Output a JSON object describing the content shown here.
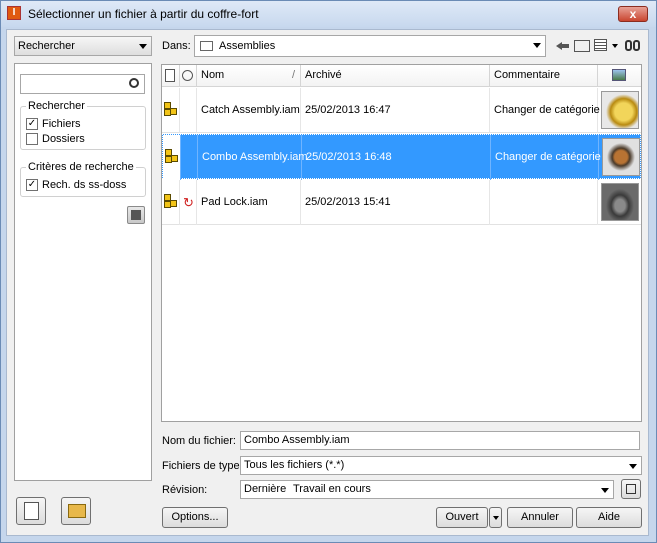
{
  "window": {
    "title": "Sélectionner un fichier à partir du coffre-fort",
    "close_label": "x",
    "app_icon": "I"
  },
  "left": {
    "mode_select": "Rechercher",
    "search_placeholder": "",
    "search_group_title": "Rechercher",
    "files_label": "Fichiers",
    "files_checked": true,
    "folders_label": "Dossiers",
    "folders_checked": false,
    "criteria_group_title": "Critères de recherche",
    "subfolders_label": "Rech. ds ss-doss",
    "subfolders_checked": true
  },
  "location": {
    "label": "Dans:",
    "folder": "Assemblies"
  },
  "grid": {
    "columns": {
      "name": "Nom",
      "archived": "Archivé",
      "comment": "Commentaire"
    },
    "rows": [
      {
        "name": "Catch Assembly.iam",
        "archived": "25/02/2013 16:47",
        "comment": "Changer de catégorie",
        "selected": false
      },
      {
        "name": "Combo Assembly.iam",
        "archived": "25/02/2013 16:48",
        "comment": "Changer de catégorie",
        "selected": true
      },
      {
        "name": "Pad Lock.iam",
        "archived": "25/02/2013 15:41",
        "comment": "",
        "selected": false
      }
    ]
  },
  "form": {
    "filename_label": "Nom du fichier:",
    "filename_value": "Combo Assembly.iam",
    "filetype_label": "Fichiers de type:",
    "filetype_value": "Tous les fichiers (*.*)",
    "revision_label": "Révision:",
    "revision_value": "Dernière",
    "revision_state": "Travail en cours"
  },
  "buttons": {
    "options": "Options...",
    "open": "Ouvert",
    "cancel": "Annuler",
    "help": "Aide"
  },
  "colors": {
    "selection": "#3399ff",
    "accent": "#e05a10"
  }
}
